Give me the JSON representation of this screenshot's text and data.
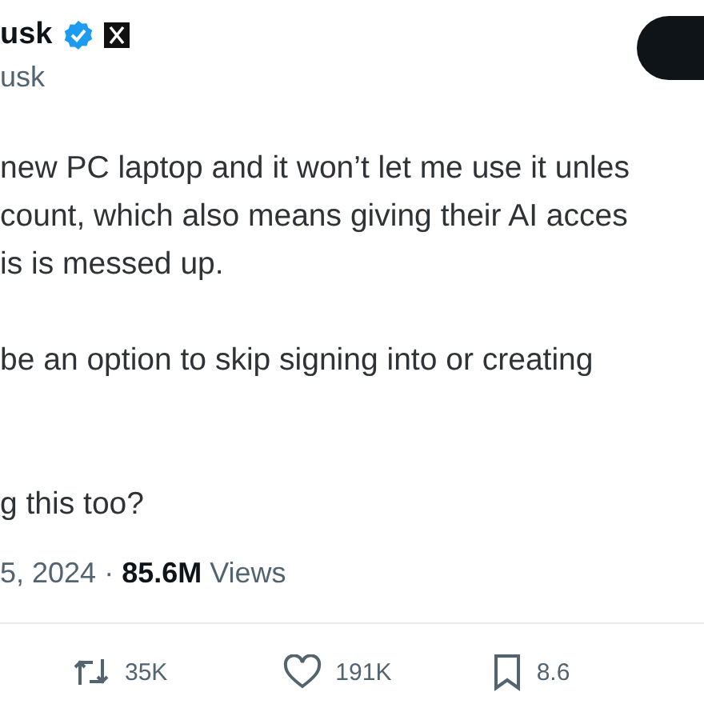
{
  "author": {
    "name": "usk",
    "verified": true,
    "handle": "usk"
  },
  "body": [
    [
      "new PC laptop and it won’t let me use it unles",
      "count, which also means giving their AI acces",
      "is is messed up."
    ],
    [
      "be an option to skip signing into or creating"
    ],
    [
      "g this too?"
    ]
  ],
  "meta": {
    "date": "5, 2024",
    "separator": "·",
    "views": "85.6M",
    "views_label": "Views"
  },
  "actions": [
    {
      "kind": "repost",
      "count": "35K"
    },
    {
      "kind": "like",
      "count": "191K"
    },
    {
      "kind": "bookmark",
      "count": "8.6"
    }
  ]
}
